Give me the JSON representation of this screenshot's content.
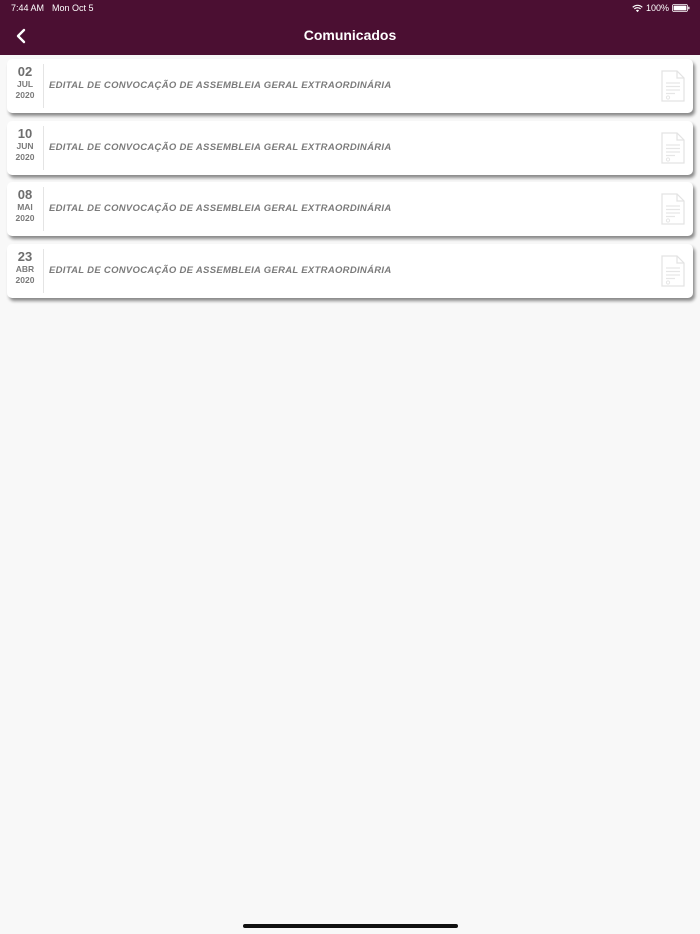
{
  "status_bar": {
    "time": "7:44 AM",
    "date": "Mon Oct 5",
    "battery": "100%"
  },
  "header": {
    "title": "Comunicados",
    "back_icon": "chevron-left-icon"
  },
  "colors": {
    "header_bg": "#4b0f32",
    "page_bg": "#f8f8f8",
    "card_bg": "#ffffff",
    "text_gray": "#7b7b7b"
  },
  "items": [
    {
      "day": "02",
      "month": "JUL",
      "year": "2020",
      "title": "EDITAL DE CONVOCAÇÃO DE ASSEMBLEIA GERAL EXTRAORDINÁRIA",
      "icon": "document-icon"
    },
    {
      "day": "10",
      "month": "JUN",
      "year": "2020",
      "title": "EDITAL DE CONVOCAÇÃO DE ASSEMBLEIA GERAL EXTRAORDINÁRIA",
      "icon": "document-icon"
    },
    {
      "day": "08",
      "month": "MAI",
      "year": "2020",
      "title": "EDITAL DE CONVOCAÇÃO DE ASSEMBLEIA GERAL EXTRAORDINÁRIA",
      "icon": "document-icon"
    },
    {
      "day": "23",
      "month": "ABR",
      "year": "2020",
      "title": "EDITAL DE CONVOCAÇÃO DE ASSEMBLEIA GERAL EXTRAORDINÁRIA",
      "icon": "document-icon"
    }
  ]
}
